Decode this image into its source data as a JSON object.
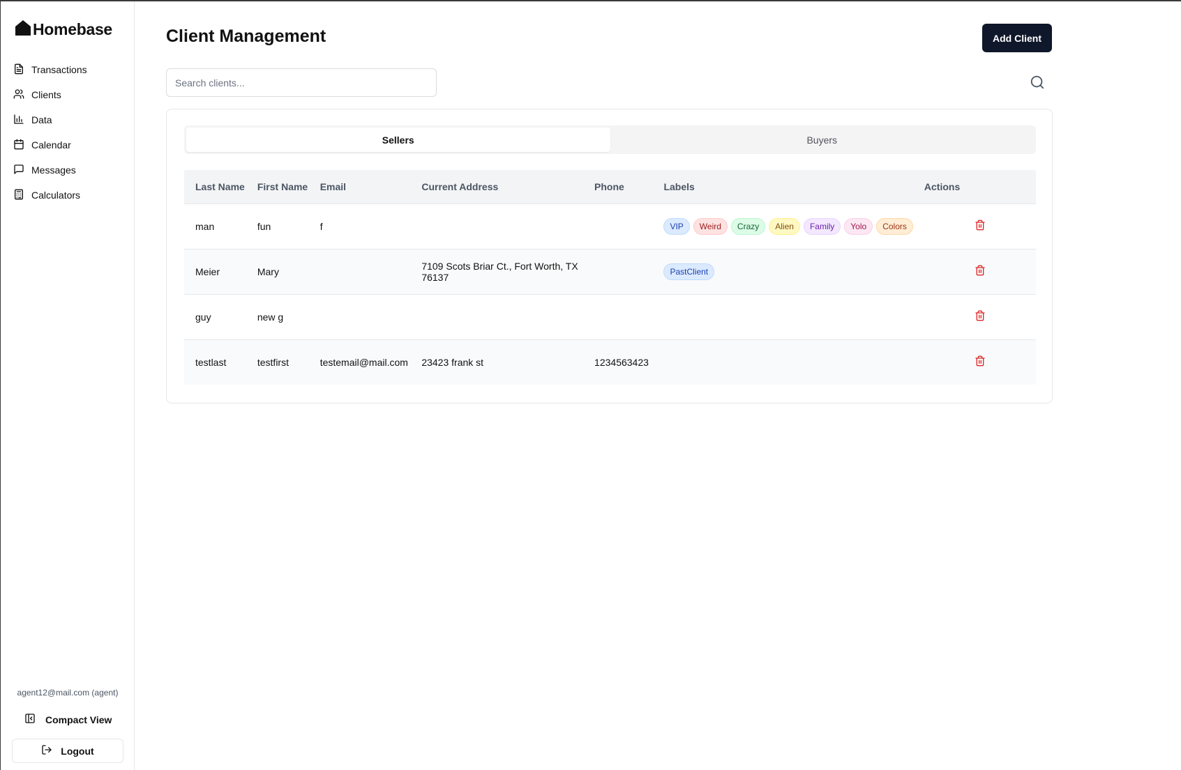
{
  "sidebar": {
    "brand": "Homebase",
    "items": [
      {
        "label": "Transactions",
        "icon": "document-icon"
      },
      {
        "label": "Clients",
        "icon": "users-icon"
      },
      {
        "label": "Data",
        "icon": "bar-chart-icon"
      },
      {
        "label": "Calendar",
        "icon": "calendar-icon"
      },
      {
        "label": "Messages",
        "icon": "message-icon"
      },
      {
        "label": "Calculators",
        "icon": "calculator-icon"
      }
    ],
    "user_email": "agent12@mail.com (agent)",
    "compact_view": "Compact View",
    "logout": "Logout"
  },
  "main": {
    "title": "Client Management",
    "add_client": "Add Client",
    "search_placeholder": "Search clients...",
    "tabs": [
      {
        "label": "Sellers",
        "active": true
      },
      {
        "label": "Buyers",
        "active": false
      }
    ],
    "table": {
      "headers": [
        "Last Name",
        "First Name",
        "Email",
        "Current Address",
        "Phone",
        "Labels",
        "Actions"
      ],
      "rows": [
        {
          "last": "man",
          "first": "fun",
          "email": "f",
          "address": "",
          "phone": "",
          "labels": [
            {
              "text": "VIP",
              "color": "blue"
            },
            {
              "text": "Weird",
              "color": "red"
            },
            {
              "text": "Crazy",
              "color": "green"
            },
            {
              "text": "Alien",
              "color": "yellow"
            },
            {
              "text": "Family",
              "color": "purple"
            },
            {
              "text": "Yolo",
              "color": "pink"
            },
            {
              "text": "Colors",
              "color": "orange"
            }
          ]
        },
        {
          "last": "Meier",
          "first": "Mary",
          "email": "",
          "address": "7109 Scots Briar Ct., Fort Worth, TX 76137",
          "phone": "",
          "labels": [
            {
              "text": "PastClient",
              "color": "blue"
            }
          ]
        },
        {
          "last": "guy",
          "first": "new g",
          "email": "",
          "address": "",
          "phone": "",
          "labels": []
        },
        {
          "last": "testlast",
          "first": "testfirst",
          "email": "testemail@mail.com",
          "address": "23423 frank st",
          "phone": "1234563423",
          "labels": []
        }
      ]
    }
  },
  "colors": {
    "primary_button": "#0f172a",
    "delete_icon": "#dc2626",
    "label_palettes": {
      "blue": {
        "bg": "#dbeafe",
        "border": "#bfdbfe",
        "text": "#1e40af"
      },
      "red": {
        "bg": "#fee2e2",
        "border": "#fecaca",
        "text": "#991b1b"
      },
      "green": {
        "bg": "#dcfce7",
        "border": "#bbf7d0",
        "text": "#166534"
      },
      "yellow": {
        "bg": "#fef9c3",
        "border": "#fef08a",
        "text": "#854d0e"
      },
      "purple": {
        "bg": "#f3e8ff",
        "border": "#e9d5ff",
        "text": "#6b21a8"
      },
      "pink": {
        "bg": "#fce7f3",
        "border": "#fbcfe8",
        "text": "#9d174d"
      },
      "orange": {
        "bg": "#ffedd5",
        "border": "#fed7aa",
        "text": "#9a3412"
      }
    }
  }
}
